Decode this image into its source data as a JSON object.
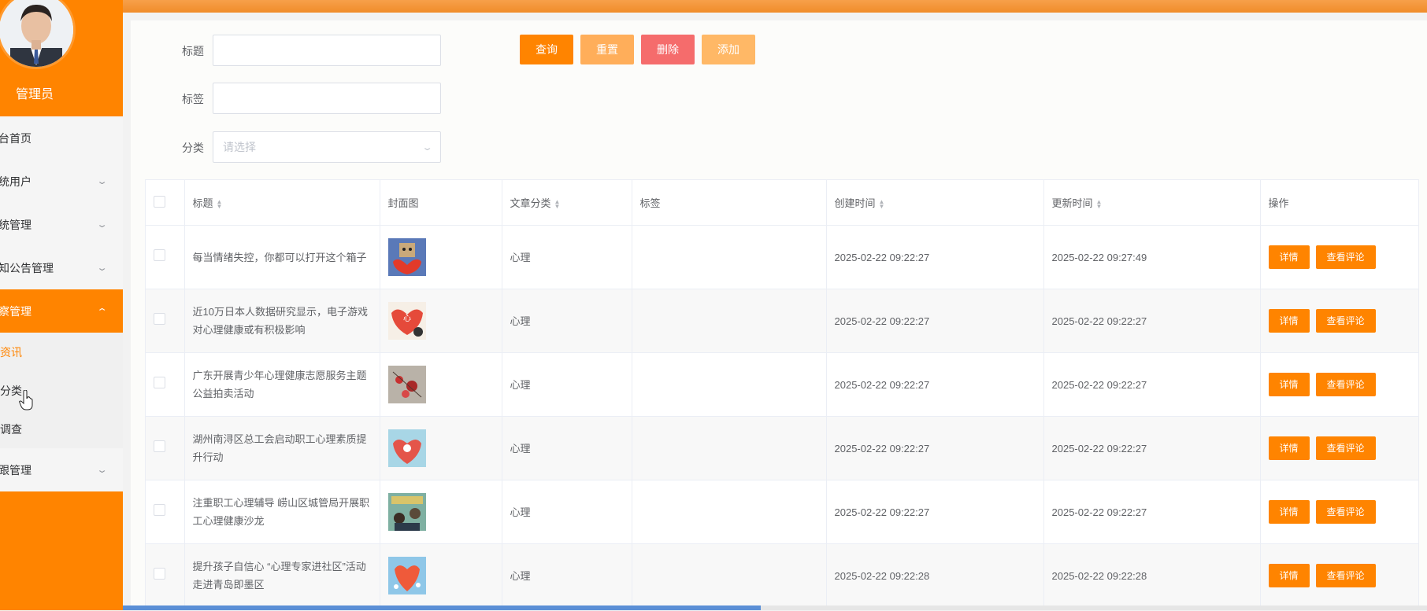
{
  "sidebar": {
    "role": "管理员",
    "menu": [
      {
        "label": "台首页",
        "has_chevron": false
      },
      {
        "label": "统用户",
        "has_chevron": true
      },
      {
        "label": "统管理",
        "has_chevron": true
      },
      {
        "label": "知公告管理",
        "has_chevron": true
      },
      {
        "label": "察管理",
        "has_chevron": true,
        "expanded": true
      }
    ],
    "submenu": [
      "资讯",
      "分类",
      "调查"
    ],
    "last": {
      "label": "跟管理"
    }
  },
  "filters": {
    "title_label": "标题",
    "tag_label": "标签",
    "category_label": "分类",
    "category_placeholder": "请选择"
  },
  "buttons": {
    "query": "查询",
    "reset": "重置",
    "delete": "删除",
    "add": "添加"
  },
  "colors": {
    "accent": "#ff8400",
    "reset": "#ffae5a",
    "delete": "#f56c6c",
    "add": "#ffb866"
  },
  "table": {
    "headers": {
      "title": "标题",
      "cover": "封面图",
      "category": "文章分类",
      "tags": "标签",
      "created": "创建时间",
      "updated": "更新时间",
      "actions": "操作"
    },
    "detail_label": "详情",
    "comments_label": "查看评论",
    "rows": [
      {
        "title": "每当情绪失控，你都可以打开这个箱子",
        "category": "心理",
        "created": "2025-02-22 09:22:27",
        "updated": "2025-02-22 09:27:49"
      },
      {
        "title": "近10万日本人数据研究显示，电子游戏对心理健康或有积极影响",
        "category": "心理",
        "created": "2025-02-22 09:22:27",
        "updated": "2025-02-22 09:22:27"
      },
      {
        "title": "广东开展青少年心理健康志愿服务主题公益拍卖活动",
        "category": "心理",
        "created": "2025-02-22 09:22:27",
        "updated": "2025-02-22 09:22:27"
      },
      {
        "title": "湖州南浔区总工会启动职工心理素质提升行动",
        "category": "心理",
        "created": "2025-02-22 09:22:27",
        "updated": "2025-02-22 09:22:27"
      },
      {
        "title": "注重职工心理辅导 崂山区城管局开展职工心理健康沙龙",
        "category": "心理",
        "created": "2025-02-22 09:22:27",
        "updated": "2025-02-22 09:22:27"
      },
      {
        "title": "提升孩子自信心 “心理专家进社区”活动走进青岛即墨区",
        "category": "心理",
        "created": "2025-02-22 09:22:28",
        "updated": "2025-02-22 09:22:28"
      }
    ]
  }
}
